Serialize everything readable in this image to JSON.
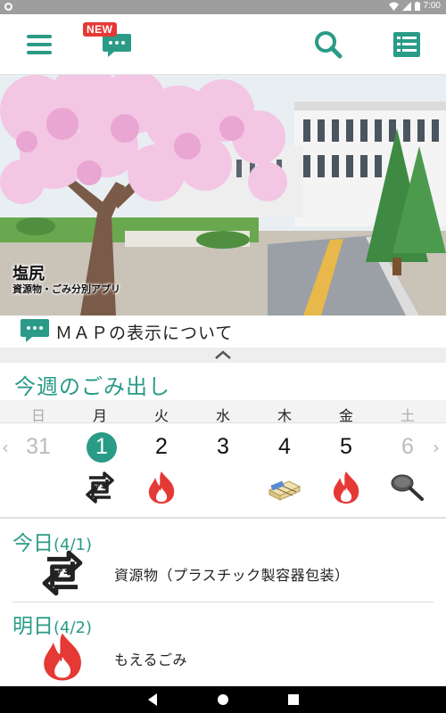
{
  "status": {
    "time": "7:00"
  },
  "appbar": {
    "new_badge": "NEW",
    "menu_icon": "hamburger-menu-icon",
    "chat_icon": "chat-bubble-icon",
    "search_icon": "search-icon",
    "list_icon": "list-icon"
  },
  "hero": {
    "title": "塩尻",
    "subtitle": "資源物・ごみ分別アプリ"
  },
  "map_notice": {
    "label": "ＭＡＰの表示について"
  },
  "week": {
    "title": "今週のごみ出し",
    "days": [
      {
        "dow": "日",
        "date": "31",
        "icon": "",
        "state": "muted"
      },
      {
        "dow": "月",
        "date": "1",
        "icon": "plastic-recycle-icon",
        "state": "today"
      },
      {
        "dow": "火",
        "date": "2",
        "icon": "burnable-flame-icon",
        "state": "normal"
      },
      {
        "dow": "水",
        "date": "3",
        "icon": "",
        "state": "normal"
      },
      {
        "dow": "木",
        "date": "4",
        "icon": "paper-bundle-icon",
        "state": "normal"
      },
      {
        "dow": "金",
        "date": "5",
        "icon": "burnable-flame-icon",
        "state": "normal"
      },
      {
        "dow": "土",
        "date": "6",
        "icon": "frying-pan-icon",
        "state": "muted"
      }
    ],
    "prev_arrow": "‹",
    "next_arrow": "›"
  },
  "today": {
    "label": "今日",
    "date": "(4/1)",
    "item": "資源物（プラスチック製容器包装）",
    "icon": "plastic-recycle-icon"
  },
  "tomorrow": {
    "label": "明日",
    "date": "(4/2)",
    "item": "もえるごみ",
    "icon": "burnable-flame-icon"
  },
  "colors": {
    "accent": "#2a9b87",
    "flame": "#e53935",
    "sakura": "#f3c6e4"
  }
}
